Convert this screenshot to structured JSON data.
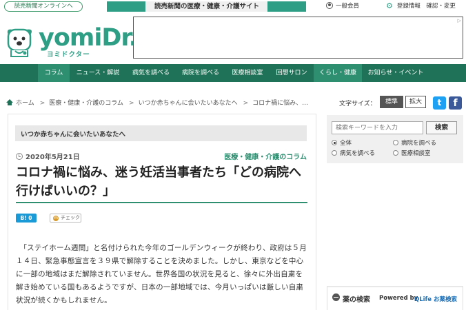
{
  "topbar": {
    "online_link": "読売新聞オンラインへ",
    "tagline": "読売新聞の医療・健康・介護サイト",
    "member_label": "一般会員",
    "register_label": "登録情報　確認・変更"
  },
  "header": {
    "logo_text": "yomiDr.",
    "logo_sub": "ヨミドクター"
  },
  "nav": {
    "items": [
      {
        "label": "コラム"
      },
      {
        "label": "ニュース・解説"
      },
      {
        "label": "病気を調べる"
      },
      {
        "label": "病院を調べる"
      },
      {
        "label": "医療相談室"
      },
      {
        "label": "回想サロン"
      },
      {
        "label": "くらし・健康"
      },
      {
        "label": "お知らせ・イベント"
      }
    ]
  },
  "breadcrumb": {
    "items": [
      {
        "label": "ホーム"
      },
      {
        "label": "医療・健康・介護のコラム"
      },
      {
        "label": "いつか赤ちゃんに会いたいあなたへ"
      },
      {
        "label": "コロナ禍に悩み、…"
      }
    ]
  },
  "font_size": {
    "label": "文字サイズ：",
    "standard": "標準",
    "large": "拡大"
  },
  "social": {
    "twitter": "t",
    "facebook": "f"
  },
  "article": {
    "series": "いつか赤ちゃんに会いたいあなたへ",
    "date": "2020年5月21日",
    "category": "医療・健康・介護のコラム",
    "title": "コロナ禍に悩み、迷う妊活当事者たち「どの病院へ行けばいいの？」",
    "bookmark_label": "B! 0",
    "check_label": "チェック",
    "check_mark": "m",
    "body": "　「ステイホーム週間」と名付けられた今年のゴールデンウィークが終わり、政府は５月１４日、緊急事態宣言を３９県で解除することを決めました。しかし、東京などを中心に一部の地域はまだ解除されていません。世界各国の状況を見ると、徐々に外出自粛を解き始めている国もあるようですが、日本の一部地域では、今月いっぱいは厳しい自粛状況が続くかもしれません。"
  },
  "sidebar": {
    "search_placeholder": "検索キーワードを入力",
    "search_button": "検索",
    "radios": [
      {
        "label": "全体"
      },
      {
        "label": "病院を調べる"
      },
      {
        "label": "病気を調べる"
      },
      {
        "label": "医療相談室"
      }
    ],
    "drug_search": {
      "title": "薬の検索",
      "powered": "Powered by",
      "provider": "QLife お薬検索"
    }
  },
  "colors": {
    "brand_green": "#2e9e84",
    "nav_dark": "#1f7257",
    "twitter": "#1da1f2",
    "facebook": "#3b5998"
  }
}
